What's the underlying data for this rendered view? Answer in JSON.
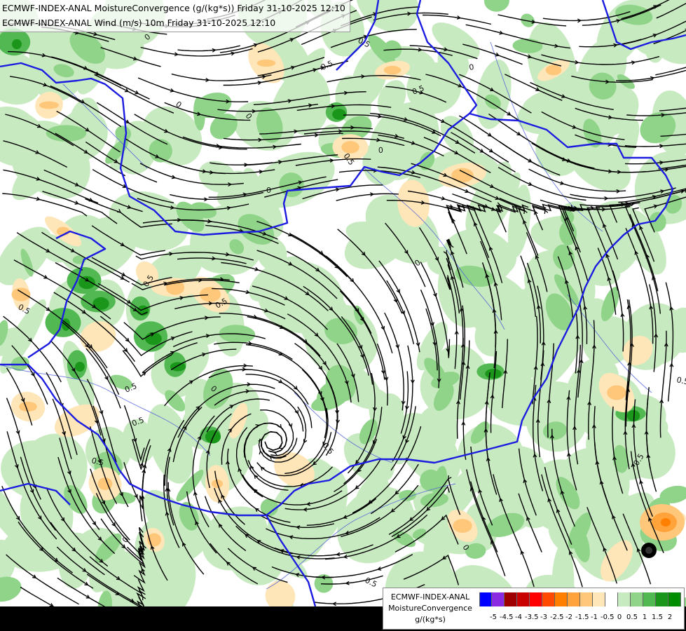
{
  "titles": {
    "line1": "ECMWF-INDEX-ANAL MoistureConvergence (g/(kg*s)) Friday 31-10-2025 12:10",
    "line2": "ECMWF-INDEX-ANAL Wind (m/s) 10m Friday 31-10-2025 12:10"
  },
  "legend": {
    "model": "ECMWF-INDEX-ANAL",
    "parameter": "MoistureConvergence",
    "unit": "g/(kg*s)",
    "ticks": [
      "-5",
      "-4.5",
      "-4",
      "-3.5",
      "-3",
      "-2.5",
      "-2",
      "-1.5",
      "-1",
      "-0.5",
      "0",
      "0.5",
      "1",
      "1.5",
      "2"
    ],
    "colors": [
      "#0000ff",
      "#8a2be2",
      "#9e0000",
      "#c80000",
      "#ff0000",
      "#ff4a00",
      "#ff7f00",
      "#ffa33a",
      "#ffc77a",
      "#ffe6b8",
      "#ffffff",
      "#c8eac0",
      "#90d48a",
      "#52b852",
      "#1a961a",
      "#008c00"
    ]
  },
  "contour_labels": [
    "0",
    "0",
    "0.5",
    "0.5",
    "0.5",
    "0",
    "0",
    "0.5",
    "0",
    "0.5",
    "0.5",
    "0",
    "0.5",
    "0.5",
    "0",
    "0.5",
    "0",
    "0.5",
    "0.5",
    "0",
    "0.5",
    "0",
    "0.5",
    "0",
    "0.5"
  ]
}
